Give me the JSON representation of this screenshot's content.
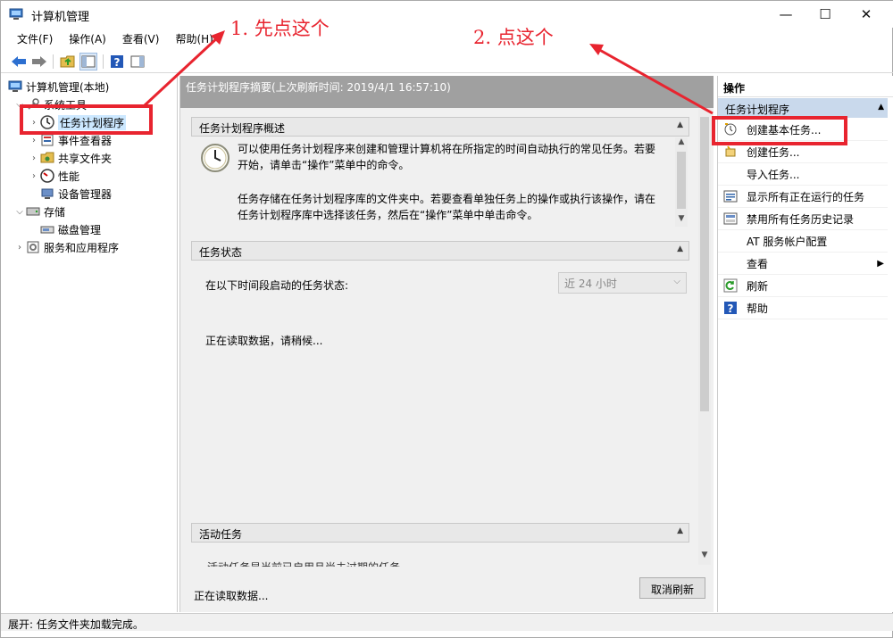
{
  "window": {
    "title": "计算机管理",
    "controls": {
      "minimize": "—",
      "maximize": "☐",
      "close": "✕"
    }
  },
  "menu": [
    "文件(F)",
    "操作(A)",
    "查看(V)",
    "帮助(H)"
  ],
  "tree": {
    "root": "计算机管理(本地)",
    "system_tools": "系统工具",
    "task_scheduler": "任务计划程序",
    "event_viewer": "事件查看器",
    "shared_folders": "共享文件夹",
    "performance": "性能",
    "device_manager": "设备管理器",
    "storage": "存储",
    "disk_management": "磁盘管理",
    "services_apps": "服务和应用程序"
  },
  "center": {
    "summary": "任务计划程序摘要(上次刷新时间: 2019/4/1 16:57:10)",
    "overview": {
      "title": "任务计划程序概述",
      "p1": "可以使用任务计划程序来创建和管理计算机将在所指定的时间自动执行的常见任务。若要开始，请单击“操作”菜单中的命令。",
      "p2": "任务存储在任务计划程序库的文件夹中。若要查看单独任务上的操作或执行该操作，请在任务计划程序库中选择该任务，然后在“操作”菜单中单击命令。"
    },
    "status": {
      "title": "任务状态",
      "label": "在以下时间段启动的任务状态:",
      "period": "近 24 小时",
      "loading": "正在读取数据，请稍候..."
    },
    "active": {
      "title": "活动任务",
      "partial": "活动任务是当前已启用且尚未过期的任务。"
    },
    "footer_status": "正在读取数据...",
    "cancel_refresh": "取消刷新"
  },
  "actions": {
    "header": "操作",
    "section": "任务计划程序",
    "items": {
      "create_basic": "创建基本任务...",
      "create_task": "创建任务...",
      "import_task": "导入任务...",
      "show_running": "显示所有正在运行的任务",
      "disable_history": "禁用所有任务历史记录",
      "at_account": "AT 服务帐户配置",
      "view": "查看",
      "refresh": "刷新",
      "help": "帮助"
    }
  },
  "statusbar": "展开: 任务文件夹加载完成。",
  "annotations": {
    "step1": "1. 先点这个",
    "step2": "2. 点这个"
  },
  "colors": {
    "annotation": "#e8242f",
    "selection": "#cce8ff",
    "section": "#c9d9ec"
  }
}
